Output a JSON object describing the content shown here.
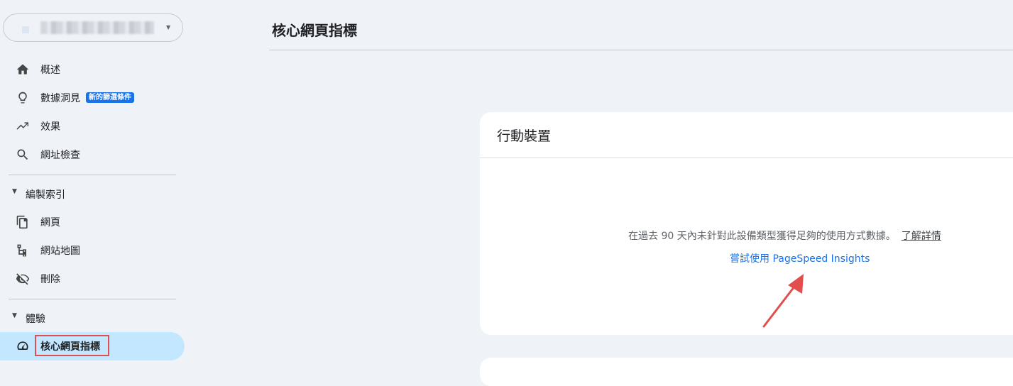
{
  "sidebar": {
    "items": [
      {
        "label": "概述",
        "icon": "home-icon"
      },
      {
        "label": "數據洞見",
        "icon": "lightbulb-icon",
        "badge": "新的篩選條件"
      },
      {
        "label": "效果",
        "icon": "trending-up-icon"
      },
      {
        "label": "網址檢查",
        "icon": "search-icon"
      }
    ],
    "sections": [
      {
        "label": "編製索引",
        "items": [
          {
            "label": "網頁",
            "icon": "pages-icon"
          },
          {
            "label": "網站地圖",
            "icon": "sitemap-icon"
          },
          {
            "label": "刪除",
            "icon": "eye-off-icon"
          }
        ]
      },
      {
        "label": "體驗",
        "items": [
          {
            "label": "核心網頁指標",
            "icon": "speed-gauge-icon",
            "active": true
          }
        ]
      }
    ]
  },
  "main": {
    "title": "核心網頁指標",
    "card": {
      "title": "行動裝置",
      "message": "在過去 90 天內未針對此設備類型獲得足夠的使用方式數據。",
      "learn_more": "了解詳情",
      "link": "嘗試使用 PageSpeed Insights"
    }
  },
  "colors": {
    "background": "#eff3f8",
    "active_nav": "#c2e7ff",
    "badge": "#1a73e8",
    "link": "#1a73e8",
    "highlight": "#e24d4d"
  }
}
